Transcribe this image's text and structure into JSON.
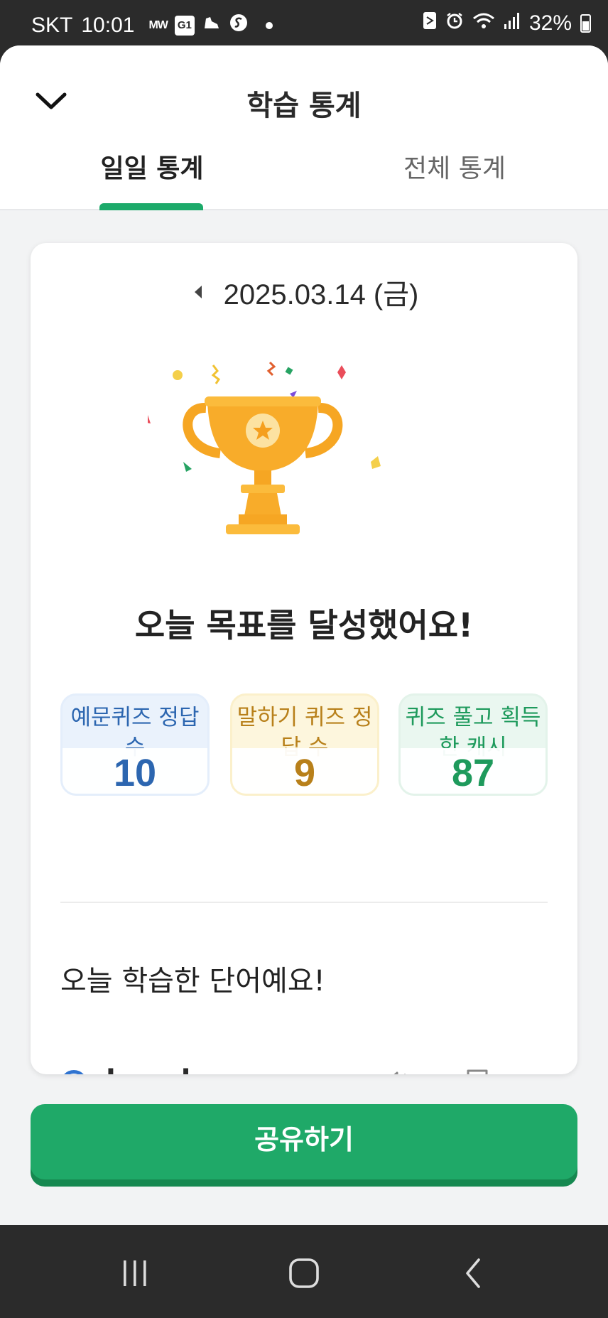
{
  "status_bar": {
    "carrier": "SKT",
    "time": "10:01",
    "notification_icons": [
      "mw-icon",
      "g1-icon",
      "sneaker-icon",
      "s-icon",
      "dot-icon"
    ],
    "mw_label": "MW",
    "g1_label": "G1",
    "battery_percent": "32%",
    "battery_level": 0.32
  },
  "header": {
    "title": "학습 통계",
    "tabs": [
      {
        "label": "일일 통계",
        "selected": true
      },
      {
        "label": "전체 통계",
        "selected": false
      }
    ]
  },
  "card": {
    "date": "2025.03.14 (금)",
    "goal_message": "오늘 목표를 달성했어요!",
    "stats": [
      {
        "label": "예문퀴즈 정답 수",
        "value": "10",
        "color": "#2c66b0"
      },
      {
        "label": "말하기 퀴즈 정답 수",
        "value": "9",
        "color": "#b8801a"
      },
      {
        "label": "퀴즈 풀고 획득한 캐시",
        "value": "87",
        "color": "#1e9a5c"
      }
    ],
    "section_title": "오늘 학습한 단어예요!",
    "words": [
      {
        "word": "break"
      }
    ]
  },
  "share_button_label": "공유하기",
  "colors": {
    "accent": "#1fa968",
    "tab_indicator": "#1caa6a",
    "trophy": "#f6a623"
  }
}
